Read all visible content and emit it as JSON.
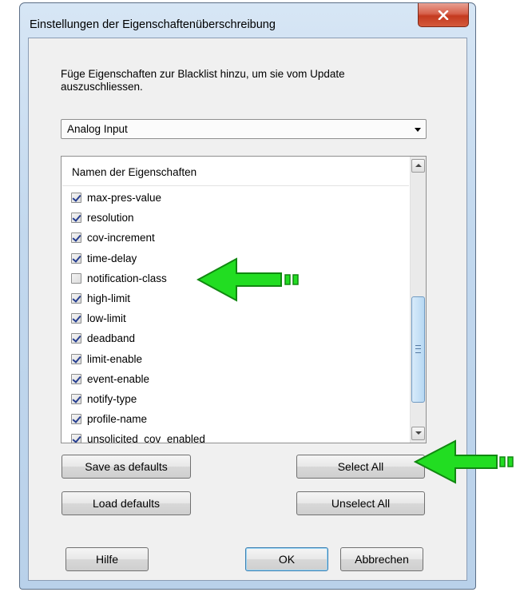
{
  "window": {
    "title": "Einstellungen der Eigenschaftenüberschreibung"
  },
  "description": "Füge Eigenschaften zur Blacklist hinzu, um sie vom Update auszuschliessen.",
  "object_type": {
    "selected": "Analog Input"
  },
  "property_list": {
    "header": "Namen der Eigenschaften",
    "items": [
      {
        "label": "max-pres-value",
        "checked": true
      },
      {
        "label": "resolution",
        "checked": true
      },
      {
        "label": "cov-increment",
        "checked": true
      },
      {
        "label": "time-delay",
        "checked": true
      },
      {
        "label": "notification-class",
        "checked": false
      },
      {
        "label": "high-limit",
        "checked": true
      },
      {
        "label": "low-limit",
        "checked": true
      },
      {
        "label": "deadband",
        "checked": true
      },
      {
        "label": "limit-enable",
        "checked": true
      },
      {
        "label": "event-enable",
        "checked": true
      },
      {
        "label": "notify-type",
        "checked": true
      },
      {
        "label": "profile-name",
        "checked": true
      },
      {
        "label": "unsolicited_cov_enabled",
        "checked": true
      }
    ]
  },
  "buttons": {
    "save_defaults": "Save as defaults",
    "load_defaults": "Load defaults",
    "select_all": "Select All",
    "unselect_all": "Unselect All",
    "help": "Hilfe",
    "ok": "OK",
    "cancel": "Abbrechen"
  },
  "annotation": {
    "arrow_color": "#22dd22"
  }
}
